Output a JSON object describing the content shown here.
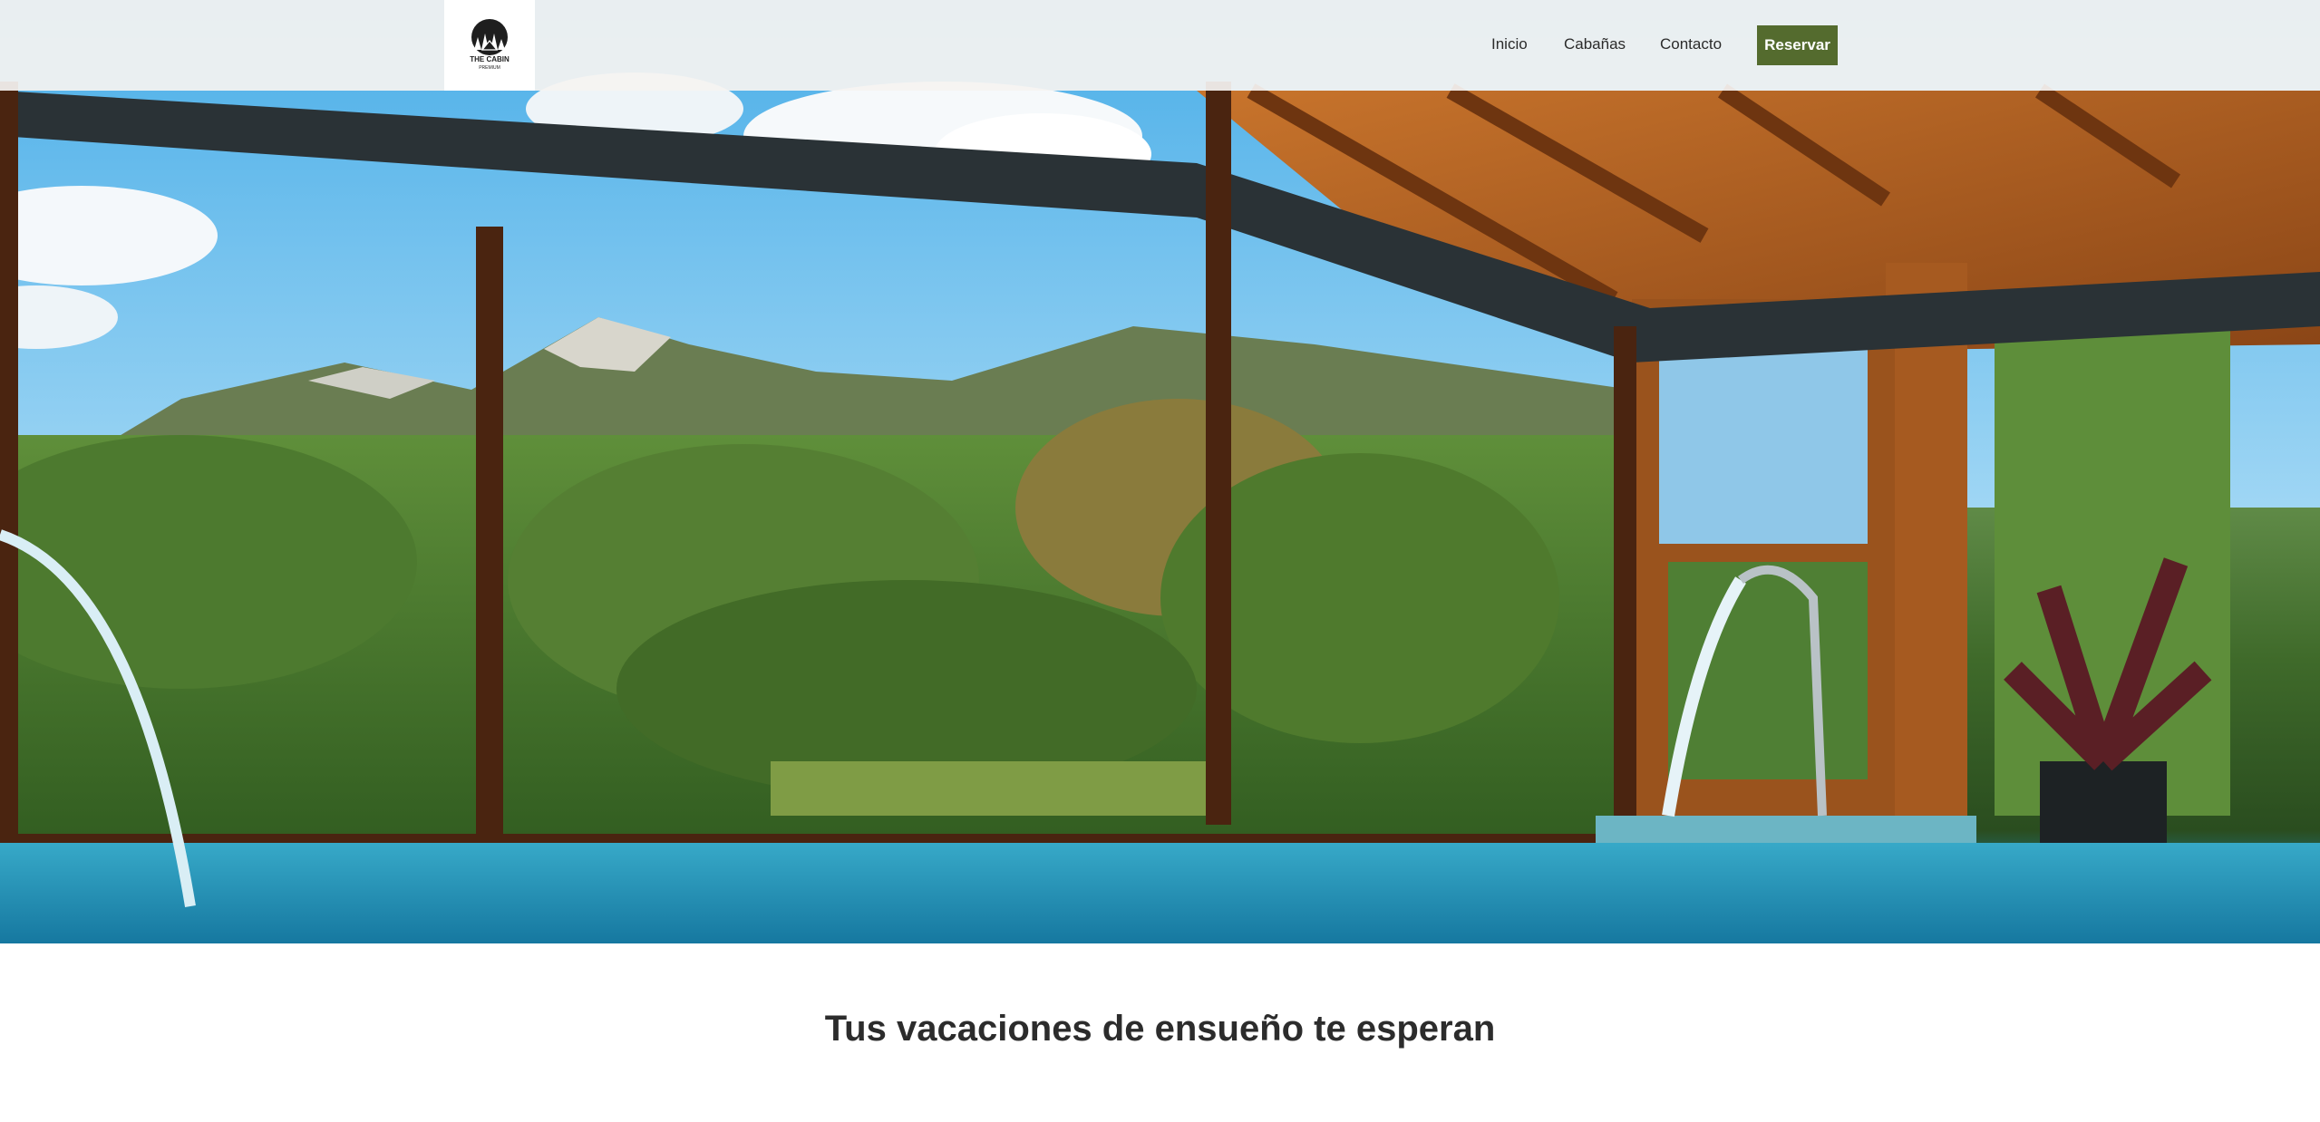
{
  "brand": {
    "logo_icon": "cabin-tree-logo",
    "logo_text": "THE CABIN",
    "logo_subtext": "PREMIUM"
  },
  "nav": {
    "items": [
      {
        "label": "Inicio"
      },
      {
        "label": "Cabañas"
      },
      {
        "label": "Contacto"
      }
    ],
    "cta_label": "Reservar"
  },
  "hero": {
    "image_subject": "indoor-pool-mountain-view"
  },
  "section": {
    "title": "Tus vacaciones de ensueño te esperan"
  },
  "colors": {
    "accent": "#546b2e",
    "nav_bg": "#f5f3f1",
    "text": "#2c2c2c"
  }
}
